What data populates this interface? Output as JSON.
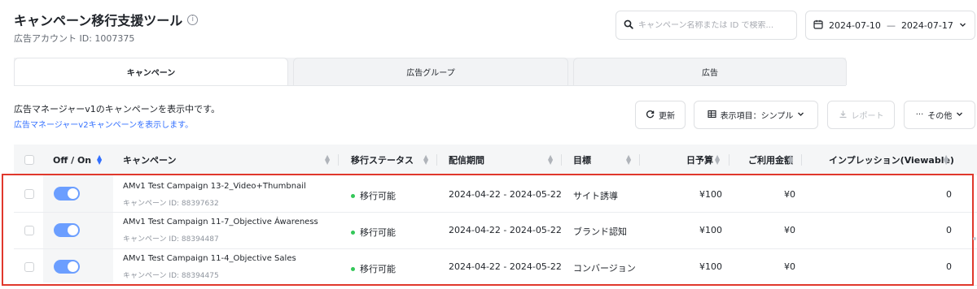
{
  "header": {
    "title": "キャンペーン移行支援ツール",
    "info_glyph": "i",
    "account_label": "広告アカウント ID: 1007375"
  },
  "search": {
    "placeholder": "キャンペーン名称または ID で検索...",
    "value": ""
  },
  "date_range": {
    "start": "2024-07-10",
    "separator": "—",
    "end": "2024-07-17"
  },
  "tabs": [
    {
      "label": "キャンペーン",
      "active": true
    },
    {
      "label": "広告グループ",
      "active": false
    },
    {
      "label": "広告",
      "active": false
    }
  ],
  "notice": {
    "line1": "広告マネージャーv1のキャンペーンを表示中です。",
    "link": "広告マネージャーv2キャンペーンを表示します。"
  },
  "toolbar": {
    "refresh_label": "更新",
    "columns_label": "表示項目：シンプル",
    "report_label": "レポート",
    "more_label": "その他",
    "more_glyph": "···"
  },
  "table": {
    "headers": {
      "onoff": "Off / On",
      "campaign": "キャンペーン",
      "status": "移行ステータス",
      "period": "配信期間",
      "goal": "目標",
      "budget": "日予算",
      "spend": "ご利用金額",
      "impressions": "インプレッション(Viewable)"
    },
    "rows": [
      {
        "on": true,
        "name": "AMv1 Test Campaign 13-2_Video+Thumbnail",
        "id_label": "キャンペーン ID: 88397632",
        "status": "移行可能",
        "period": "2024-04-22 - 2024-05-22",
        "goal": "サイト誘導",
        "budget": "¥100",
        "spend": "¥0",
        "impressions": "0"
      },
      {
        "on": true,
        "name": "AMv1 Test Campaign 11-7_Objective Áwareness",
        "id_label": "キャンペーン ID: 88394487",
        "status": "移行可能",
        "period": "2024-04-22 - 2024-05-22",
        "goal": "ブランド認知",
        "budget": "¥100",
        "spend": "¥0",
        "impressions": "0"
      },
      {
        "on": true,
        "name": "AMv1 Test Campaign 11-4_Objective Sales",
        "id_label": "キャンペーン ID: 88394475",
        "status": "移行可能",
        "period": "2024-04-22 - 2024-05-22",
        "goal": "コンバージョン",
        "budget": "¥100",
        "spend": "¥0",
        "impressions": "0"
      }
    ]
  },
  "colors": {
    "accent": "#3370ff",
    "toggle_on": "#6b9eff",
    "status_dot": "#34c759",
    "highlight_border": "#e0382c"
  }
}
